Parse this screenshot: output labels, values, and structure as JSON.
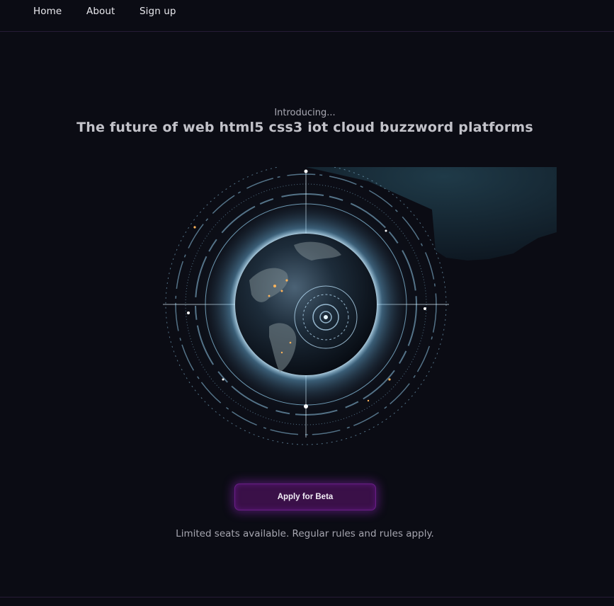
{
  "nav": {
    "items": [
      {
        "label": "Home"
      },
      {
        "label": "About"
      },
      {
        "label": "Sign up"
      }
    ]
  },
  "hero": {
    "kicker": "Introducing...",
    "headline": "The future of web html5 css3 iot cloud buzzword platforms",
    "image_icon": "globe-tech-illustration"
  },
  "cta": {
    "label": "Apply for Beta",
    "note": "Limited seats available. Regular rules and rules apply."
  },
  "colors": {
    "background": "#0b0c14",
    "accent": "#3a1048",
    "accent_border": "#6a1e86",
    "divider": "#261b36"
  }
}
